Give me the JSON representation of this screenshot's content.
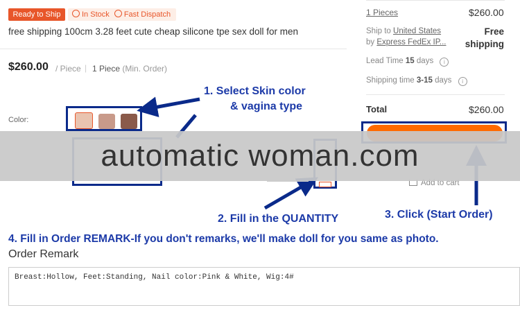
{
  "product": {
    "badge_ready": "Ready to Ship",
    "badge_stock": "In Stock",
    "badge_dispatch": "Fast Dispatch",
    "title": "free shipping 100cm 3.28 feet cute cheap silicone tpe sex doll for men",
    "price": "$260.00",
    "price_unit": "/ Piece",
    "min_order_qty": "1 Piece",
    "min_order_label": "(Min. Order)",
    "color_label": "Color:"
  },
  "annotations": {
    "step1_line1": "1. Select Skin color",
    "step1_line2": "& vagina type",
    "step2": "2. Fill in the QUANTITY",
    "step3": "3. Click (Start Order)",
    "step4": "4. Fill in Order REMARK-If you don't remarks, we'll make doll for you same as photo."
  },
  "order_panel": {
    "pieces": "1 Pieces",
    "pieces_price": "$260.00",
    "ship_to_label": "Ship to",
    "ship_to_country": "United States",
    "ship_by_label": "by",
    "ship_method": "Express FedEx IP...",
    "free_shipping_line1": "Free",
    "free_shipping_line2": "shipping",
    "lead_time_label": "Lead Time",
    "lead_time_value": "15",
    "lead_time_unit": "days",
    "shipping_time_label": "Shipping time",
    "shipping_time_value": "3-15",
    "shipping_time_unit": "days",
    "total_label": "Total",
    "total_value": "$260.00",
    "add_to_cart": "Add to cart"
  },
  "banner": {
    "text": "automatic woman.com"
  },
  "remark": {
    "title": "Order Remark",
    "value": "Breast:Hollow, Feet:Standing, Nail color:Pink & White, Wig:4#"
  },
  "colors": {
    "accent_orange": "#ff6a00",
    "badge_red": "#e8562a",
    "annotation_blue": "#1c3aa8",
    "box_navy": "#0a2a8a"
  }
}
